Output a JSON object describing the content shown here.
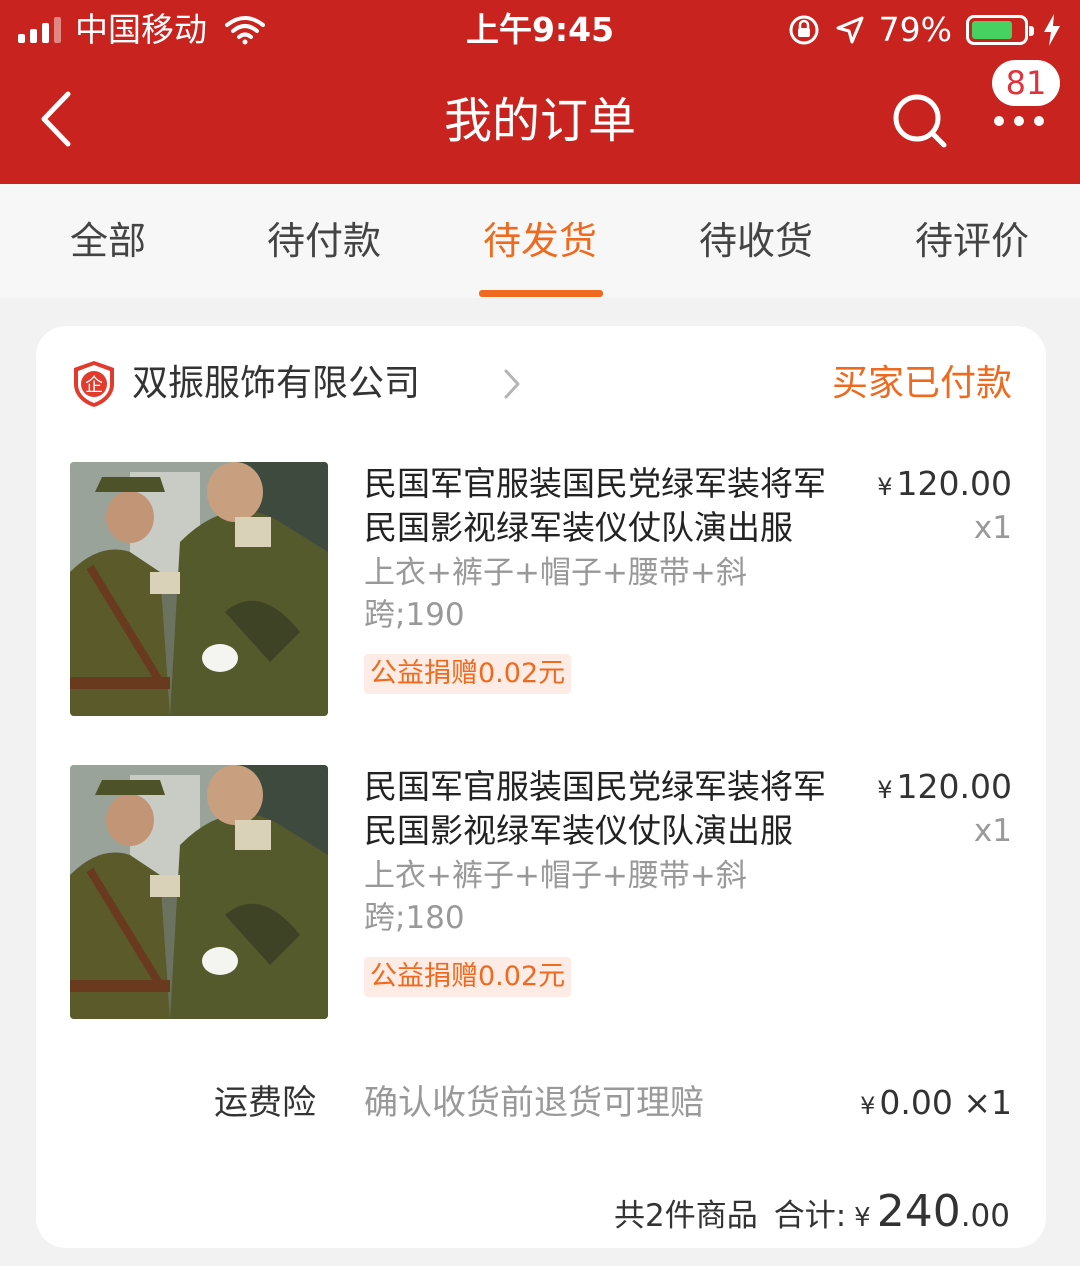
{
  "status_bar": {
    "carrier": "中国移动",
    "time": "上午9:45",
    "battery_percent": "79%",
    "battery_level": 0.79
  },
  "nav": {
    "title": "我的订单",
    "badge_count": "81"
  },
  "tabs": [
    {
      "label": "全部"
    },
    {
      "label": "待付款"
    },
    {
      "label": "待发货"
    },
    {
      "label": "待收货"
    },
    {
      "label": "待评价"
    }
  ],
  "active_tab": "待发货",
  "order": {
    "shop_name": "双振服饰有限公司",
    "shop_icon": "enterprise-shield-icon",
    "status": "买家已付款",
    "items": [
      {
        "title": "民国军官服装国民党绿军装将军民国影视绿军装仪仗队演出服",
        "price_symbol": "¥",
        "price": "120.00",
        "quantity": "x1",
        "sku": "上衣+裤子+帽子+腰带+斜跨;190",
        "donation": "公益捐赠0.02元"
      },
      {
        "title": "民国军官服装国民党绿军装将军民国影视绿军装仪仗队演出服",
        "price_symbol": "¥",
        "price": "120.00",
        "quantity": "x1",
        "sku": "上衣+裤子+帽子+腰带+斜跨;180",
        "donation": "公益捐赠0.02元"
      }
    ],
    "shipping_insurance": {
      "label": "运费险",
      "description": "确认收货前退货可理赔",
      "price_symbol": "¥",
      "price": "0.00",
      "quantity": "×1"
    },
    "summary": {
      "count_text": "共2件商品",
      "total_label": "合计:",
      "currency": "¥",
      "total_integer": "240",
      "total_decimal": ".00"
    }
  },
  "colors": {
    "header_bg": "#c8231e",
    "accent": "#ef6a1f",
    "badge_text": "#e0323a"
  }
}
